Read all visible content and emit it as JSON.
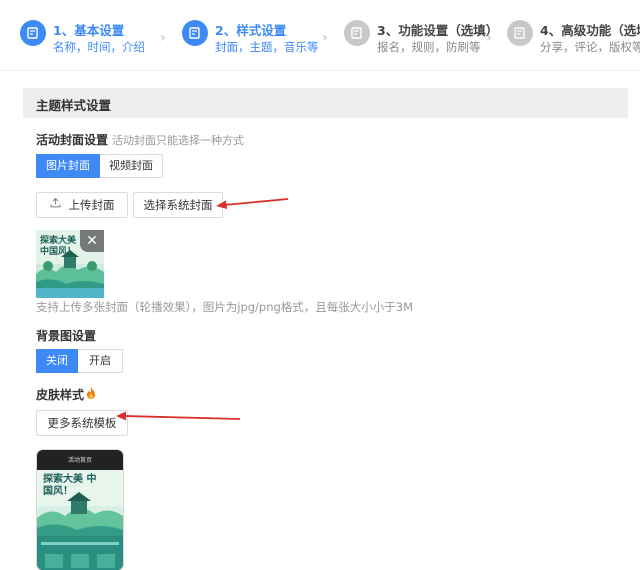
{
  "steps": [
    {
      "title": "1、基本设置",
      "sub": "名称，时间，介绍",
      "active": true
    },
    {
      "title": "2、样式设置",
      "sub": "封面，主题，音乐等",
      "active": true
    },
    {
      "title": "3、功能设置（选填）",
      "sub": "报名，规则，防刷等",
      "active": false
    },
    {
      "title": "4、高级功能（选填）",
      "sub": "分享，评论，版权等",
      "active": false
    }
  ],
  "panel": {
    "title": "主题样式设置"
  },
  "cover": {
    "label": "活动封面设置",
    "hint": "活动封面只能选择一种方式",
    "options": [
      "图片封面",
      "视频封面"
    ],
    "selected": "图片封面",
    "upload_label": "上传封面",
    "system_label": "选择系统封面",
    "thumb_text": "探索大美 中国风！",
    "note": "支持上传多张封面（轮播效果），图片为jpg/png格式，且每张大小小于3M"
  },
  "background": {
    "label": "背景图设置",
    "options": [
      "关闭",
      "开启"
    ],
    "selected": "关闭"
  },
  "skin": {
    "label": "皮肤样式",
    "more_label": "更多系统模板",
    "preview_title": "活动首页"
  },
  "colors": {
    "accent": "#3d8af7",
    "arrow": "#d9302c"
  }
}
